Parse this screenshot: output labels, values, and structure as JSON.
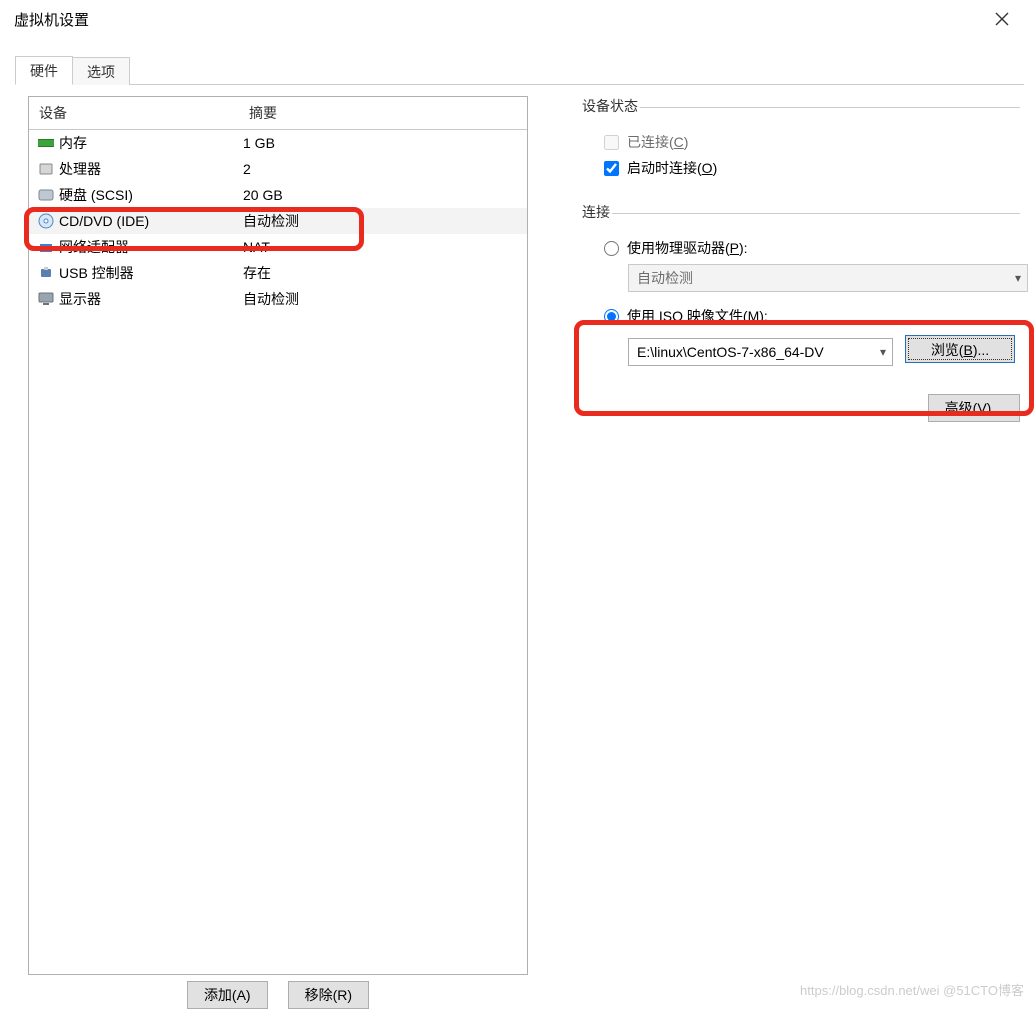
{
  "window": {
    "title": "虚拟机设置"
  },
  "tabs": {
    "hardware": "硬件",
    "options": "选项"
  },
  "columns": {
    "device": "设备",
    "summary": "摘要"
  },
  "devices": [
    {
      "name": "内存",
      "summary": "1 GB",
      "icon": "memory"
    },
    {
      "name": "处理器",
      "summary": "2",
      "icon": "cpu"
    },
    {
      "name": "硬盘 (SCSI)",
      "summary": "20 GB",
      "icon": "disk"
    },
    {
      "name": "CD/DVD (IDE)",
      "summary": "自动检测",
      "icon": "cd",
      "selected": true
    },
    {
      "name": "网络适配器",
      "summary": "NAT",
      "icon": "net"
    },
    {
      "name": "USB 控制器",
      "summary": "存在",
      "icon": "usb"
    },
    {
      "name": "显示器",
      "summary": "自动检测",
      "icon": "display"
    }
  ],
  "buttons": {
    "add": "添加(A)",
    "remove": "移除(R)",
    "browse": "浏览(B)...",
    "advanced": "高级(V)..."
  },
  "deviceStatus": {
    "legend": "设备状态",
    "connected": "已连接(C)",
    "connectAtPowerOn": "启动时连接(O)"
  },
  "connection": {
    "legend": "连接",
    "physical": "使用物理驱动器(P):",
    "physicalValue": "自动检测",
    "iso": "使用 ISO 映像文件(M):",
    "isoPath": "E:\\linux\\CentOS-7-x86_64-DV"
  },
  "watermark": "https://blog.csdn.net/wei @51CTO博客"
}
